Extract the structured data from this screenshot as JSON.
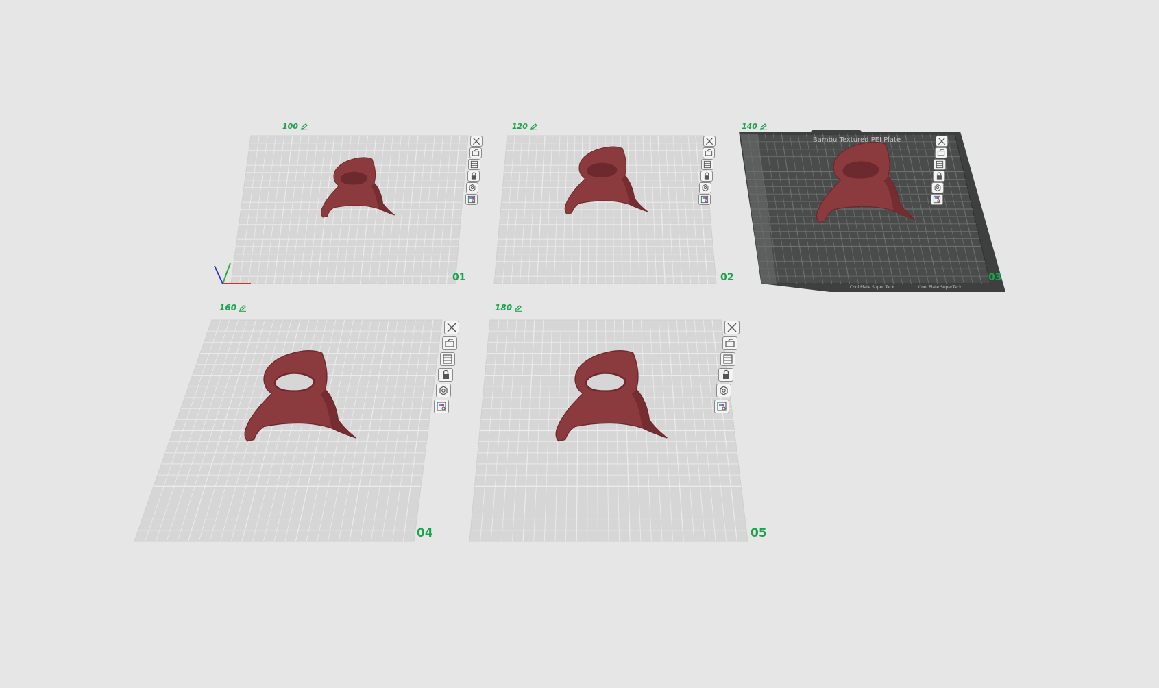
{
  "colors": {
    "background": "#e6e6e6",
    "plate_light": "#d6d6d6",
    "plate_grid_light": "#ececec",
    "plate_dark": "#4a4c4c",
    "plate_grid_dark": "#6e7070",
    "model": "#8b3a3e",
    "model_shade": "#6d2a2e",
    "label_green": "#1aa34a"
  },
  "plates": [
    {
      "name": "100",
      "number": "01",
      "selected": false
    },
    {
      "name": "120",
      "number": "02",
      "selected": false
    },
    {
      "name": "140",
      "number": "03",
      "selected": true
    },
    {
      "name": "160",
      "number": "04",
      "selected": false
    },
    {
      "name": "180",
      "number": "05",
      "selected": false
    }
  ],
  "plate_tool_icons": [
    "close-plate-icon",
    "arrange-plate-icon",
    "orient-plate-icon",
    "lock-plate-icon",
    "plate-settings-icon",
    "plate-filament-icon"
  ],
  "edit_icon": "pencil-icon",
  "selected_plate_text": {
    "top": "Bambu Textured PEI Plate",
    "bottom_left": "Cool Plate Super Tack",
    "bottom_right": "Cool Plate SuperTack"
  }
}
